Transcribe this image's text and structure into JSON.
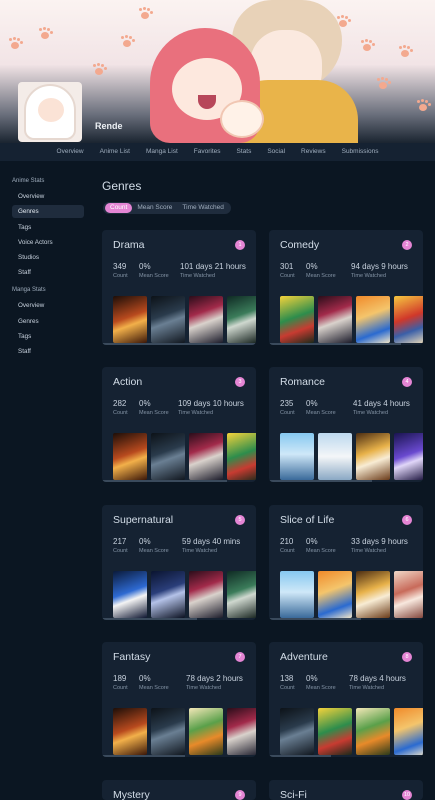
{
  "profile": {
    "username": "Rende"
  },
  "nav": [
    "Overview",
    "Anime List",
    "Manga List",
    "Favorites",
    "Stats",
    "Social",
    "Reviews",
    "Submissions"
  ],
  "sidebar": {
    "anime_heading": "Anime Stats",
    "anime_items": [
      "Overview",
      "Genres",
      "Tags",
      "Voice Actors",
      "Studios",
      "Staff"
    ],
    "manga_heading": "Manga Stats",
    "manga_items": [
      "Overview",
      "Genres",
      "Tags",
      "Staff"
    ]
  },
  "main": {
    "title": "Genres",
    "pills": [
      "Count",
      "Mean Score",
      "Time Watched"
    ]
  },
  "labels": {
    "count": "Count",
    "mean": "Mean Score",
    "time": "Time Watched"
  },
  "colors": {
    "accent": "#e485d4",
    "background": "#0b1622",
    "card": "#152232"
  },
  "genres": [
    {
      "name": "Drama",
      "rank": "1",
      "count": "349",
      "mean": "0%",
      "time": "101 days 21 hours"
    },
    {
      "name": "Comedy",
      "rank": "2",
      "count": "301",
      "mean": "0%",
      "time": "94 days 9 hours"
    },
    {
      "name": "Action",
      "rank": "3",
      "count": "282",
      "mean": "0%",
      "time": "109 days 10 hours"
    },
    {
      "name": "Romance",
      "rank": "4",
      "count": "235",
      "mean": "0%",
      "time": "41 days 4 hours"
    },
    {
      "name": "Supernatural",
      "rank": "5",
      "count": "217",
      "mean": "0%",
      "time": "59 days 40 mins"
    },
    {
      "name": "Slice of Life",
      "rank": "6",
      "count": "210",
      "mean": "0%",
      "time": "33 days 9 hours"
    },
    {
      "name": "Fantasy",
      "rank": "7",
      "count": "189",
      "mean": "0%",
      "time": "78 days 2 hours"
    },
    {
      "name": "Adventure",
      "rank": "8",
      "count": "138",
      "mean": "0%",
      "time": "78 days 4 hours"
    },
    {
      "name": "Mystery",
      "rank": "9"
    },
    {
      "name": "Sci-Fi",
      "rank": "10"
    }
  ]
}
